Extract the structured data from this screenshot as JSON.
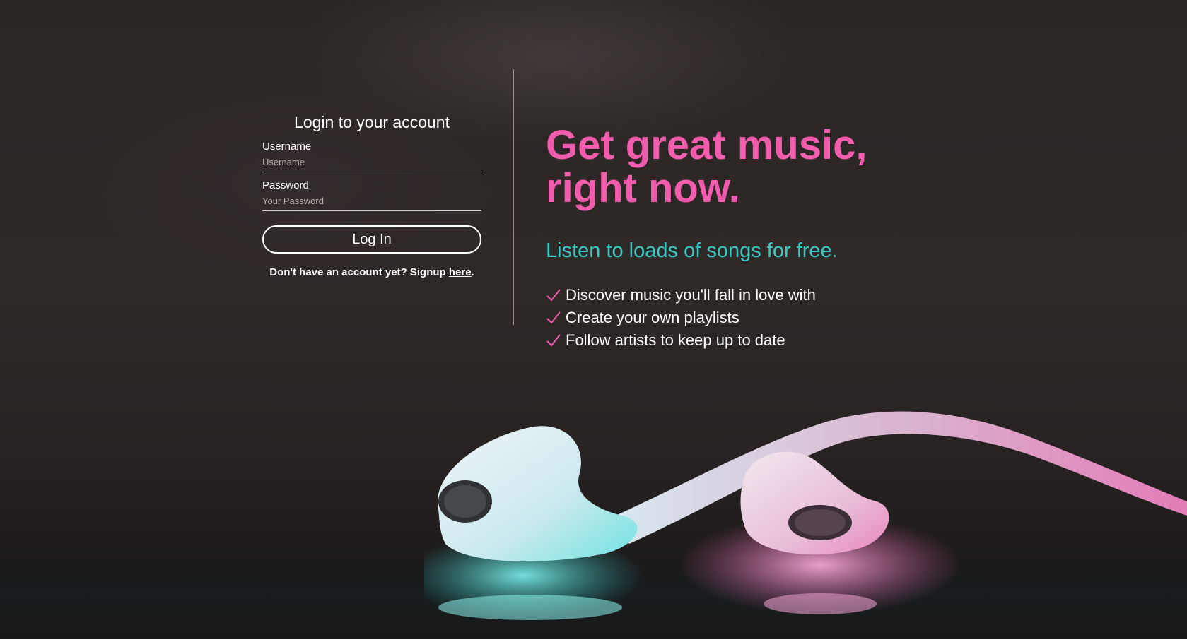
{
  "login": {
    "title": "Login to your account",
    "username_label": "Username",
    "username_placeholder": "Username",
    "password_label": "Password",
    "password_placeholder": "Your Password",
    "button_label": "Log In",
    "signup_text": "Don't have an account yet? Signup ",
    "signup_link": "here",
    "signup_end": "."
  },
  "promo": {
    "headline_line1": "Get great music,",
    "headline_line2": "right now.",
    "subheadline": "Listen to loads of songs for free.",
    "features": [
      "Discover music you'll fall in love with",
      "Create your own playlists",
      "Follow artists to keep up to date"
    ]
  },
  "colors": {
    "accent_pink": "#f25cad",
    "accent_teal": "#37c9c2",
    "background": "#2b2624",
    "text": "#ffffff"
  },
  "icons": {
    "feature_bullet": "check-icon"
  }
}
